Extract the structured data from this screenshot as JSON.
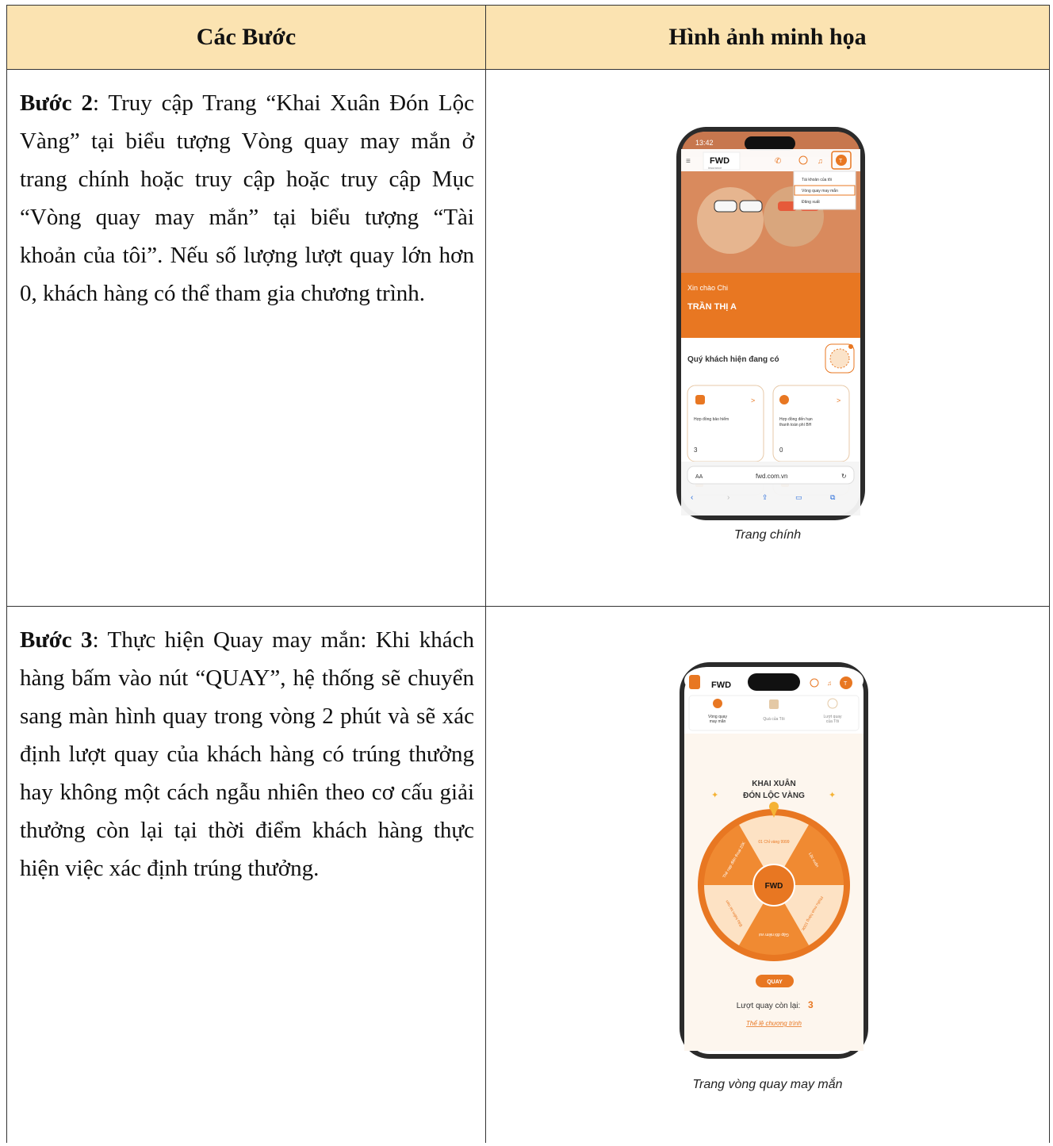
{
  "header": {
    "col1": "Các Bước",
    "col2": "Hình ảnh minh họa"
  },
  "steps": [
    {
      "label": "Bước 2",
      "text": ": Truy cập Trang “Khai Xuân Đón Lộc Vàng” tại biểu tượng Vòng quay may mắn ở trang chính hoặc truy cập hoặc truy cập Mục “Vòng quay may mắn” tại biểu tượng “Tài khoản của tôi”. Nếu số lượng lượt quay lớn hơn 0, khách hàng có thể tham gia chương trình.",
      "caption": "Trang chính"
    },
    {
      "label": "Bước 3",
      "text": ": Thực hiện Quay may mắn: Khi khách hàng bấm vào nút “QUAY”, hệ thống sẽ chuyển sang màn hình quay trong vòng 2 phút và sẽ xác định lượt quay của khách hàng có trúng thưởng hay không một cách ngẫu nhiên theo cơ cấu giải thưởng còn lại tại thời điểm khách hàng thực hiện việc xác định trúng thưởng.",
      "caption": "Trang vòng quay may mắn"
    }
  ],
  "phone1": {
    "time": "13:42",
    "logo": "FWD",
    "logo_sub": "insurance",
    "menu": [
      "Tài khoản của tôi",
      "Vòng quay may mắn",
      "Đăng xuất"
    ],
    "greeting": "Xin chào Chi",
    "name": "TRẦN THỊ A",
    "summary": "Quý khách hiện đang có",
    "card1_label": "Hợp đồng bảo hiểm",
    "card1_value": "3",
    "card2_label1": "Hợp đồng đến hạn",
    "card2_label2": "thanh toán phí BH",
    "card2_value": "0",
    "text_size": "AA",
    "url": "fwd.com.vn"
  },
  "phone2": {
    "logo": "FWD",
    "tabs": [
      [
        "Vòng quay",
        "may mắn"
      ],
      [
        "Quà của Tôi",
        ""
      ],
      [
        "Lượt quay",
        "của Tôi"
      ]
    ],
    "title1": "KHAI XUÂN",
    "title2": "ĐÓN LỘC VÀNG",
    "segments": [
      "01 Chỉ vàng 9999",
      "Lộc xuân",
      "Phiếu mua hàng 100K",
      "Gặp đôi niềm vui",
      "Bảo hiểm tai nạn",
      "Thẻ nạp điện thoại 20K"
    ],
    "center_logo": "FWD",
    "button": "QUAY",
    "remaining_label": "Lượt quay còn lại:",
    "remaining_value": "3",
    "rules_link": "Thể lệ chương trình"
  },
  "colors": {
    "orange": "#e87722",
    "header_bg": "#fbe3b1"
  }
}
